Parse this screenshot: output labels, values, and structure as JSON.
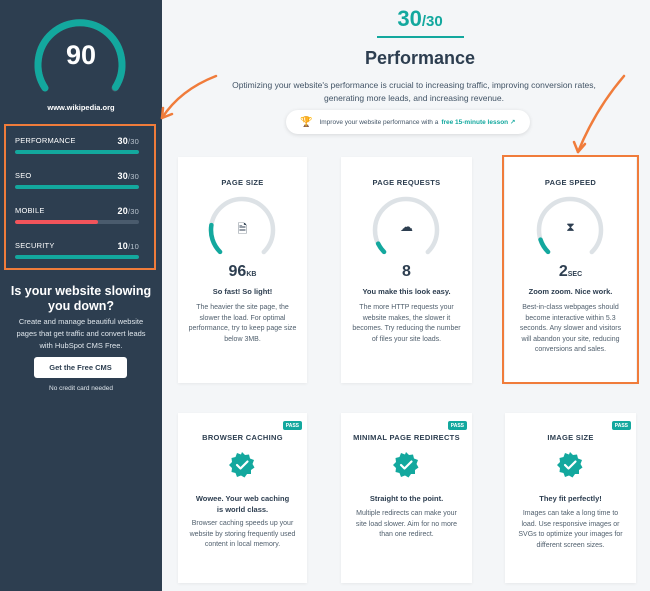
{
  "sidebar": {
    "overall_score": "90",
    "site": "www.wikipedia.org",
    "metrics": [
      {
        "label": "PERFORMANCE",
        "score": "30",
        "max": "/30",
        "fraction": 1.0,
        "color": "#13a89e"
      },
      {
        "label": "SEO",
        "score": "30",
        "max": "/30",
        "fraction": 1.0,
        "color": "#13a89e"
      },
      {
        "label": "MOBILE",
        "score": "20",
        "max": "/30",
        "fraction": 0.667,
        "color": "#f2545b"
      },
      {
        "label": "SECURITY",
        "score": "10",
        "max": "/10",
        "fraction": 1.0,
        "color": "#13a89e"
      }
    ],
    "heading": "Is your website slowing you down?",
    "text": "Create and manage beautiful website pages that get traffic and convert leads with HubSpot CMS Free.",
    "cta": "Get the Free CMS",
    "note": "No credit card needed"
  },
  "header": {
    "score": "30",
    "max": "/30",
    "title": "Performance",
    "intro": "Optimizing your website's performance is crucial to increasing traffic, improving conversion rates, generating more leads, and increasing revenue.",
    "pill_text": "Improve your website performance with a",
    "pill_link": "free 15-minute lesson ↗"
  },
  "cards": [
    {
      "title": "PAGE SIZE",
      "value": "96",
      "unit": "KB",
      "head": "So fast! So light!",
      "desc": "The heavier the site page, the slower the load. For optimal performance, try to keep page size below 3MB.",
      "icon": "file-icon",
      "level": 0.2
    },
    {
      "title": "PAGE REQUESTS",
      "value": "8",
      "unit": "",
      "head": "You make this look easy.",
      "desc": "The more HTTP requests your website makes, the slower it becomes. Try reducing the number of files your site loads.",
      "icon": "cloud-upload-icon",
      "level": 0.07
    },
    {
      "title": "PAGE SPEED",
      "value": "2",
      "unit": "SEC",
      "head": "Zoom zoom. Nice work.",
      "desc": "Best-in-class webpages should become interactive within 5.3 seconds. Any slower and visitors will abandon your site, reducing conversions and sales.",
      "icon": "hourglass-icon",
      "level": 0.1
    },
    {
      "title": "BROWSER CACHING",
      "badge": "PASS",
      "head": "Wowee. Your web caching is world class.",
      "desc": "Browser caching speeds up your website by storing frequently used content in local memory.",
      "icon": "check-icon"
    },
    {
      "title": "MINIMAL PAGE REDIRECTS",
      "badge": "PASS",
      "head": "Straight to the point.",
      "desc": "Multiple redirects can make your site load slower. Aim for no more than one redirect.",
      "icon": "check-icon"
    },
    {
      "title": "IMAGE SIZE",
      "badge": "PASS",
      "head": "They fit perfectly!",
      "desc": "Images can take a long time to load. Use responsive images or SVGs to optimize your images for different screen sizes.",
      "icon": "check-icon"
    }
  ],
  "colors": {
    "accent": "#13a89e",
    "navy": "#2d3e50",
    "highlight": "#f07c3b",
    "danger": "#f2545b"
  }
}
